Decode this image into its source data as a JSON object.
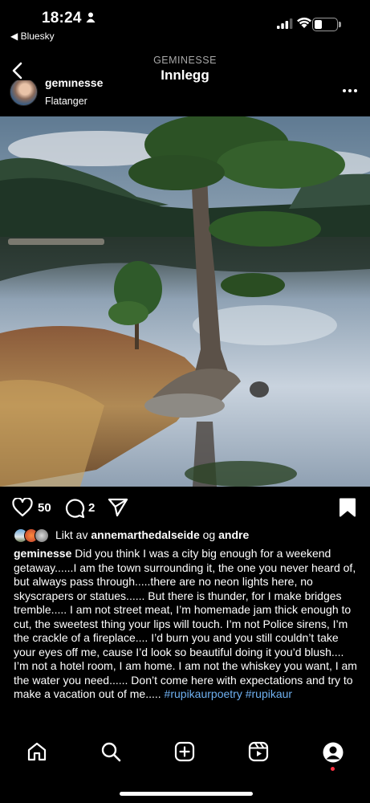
{
  "status_bar": {
    "time": "18:24",
    "back_app": "◀ Bluesky",
    "battery_percent": 25
  },
  "nav": {
    "subtitle": "GEMINESSE",
    "title": "Innlegg"
  },
  "post": {
    "username": "geminesse",
    "location": "Flatanger",
    "likes_count": "50",
    "comments_count": "2",
    "liked_by_prefix": "Likt av",
    "liked_by_user": "annemarthedalseide",
    "liked_by_and": "og",
    "liked_by_others": "andre",
    "caption_username": "geminesse",
    "caption_text": "Did you think I was a city big enough for a weekend getaway......I am the town surrounding it, the one you never heard of, but always pass through.....there are no neon lights here, no skyscrapers or statues...... But there is thunder, for I make bridges tremble..... I am not street meat, I’m homemade jam thick enough to cut, the sweetest thing your lips will touch. I’m not Police sirens, I’m the crackle of a fireplace.... I’d burn you and you still couldn’t take your eyes off me, cause I’d look so beautiful doing it you’d blush.... I’m not a hotel room, I am home. I am not the whiskey you want, I am the water you need...... Don’t come here with expectations and try to make a vacation out of me.....",
    "hashtags": [
      "#rupikaurpoetry",
      "#rupikaur"
    ]
  },
  "icons": {
    "like": "heart-icon",
    "comment": "comment-icon",
    "share": "send-icon",
    "save": "bookmark-icon",
    "tabs": [
      "home-icon",
      "search-icon",
      "create-icon",
      "reels-icon",
      "profile-icon"
    ]
  },
  "colors": {
    "background": "#000000",
    "hashtag": "#6fb0f0",
    "notification": "#ff3040"
  }
}
